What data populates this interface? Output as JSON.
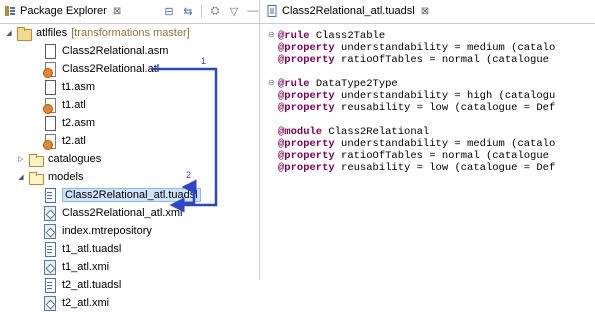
{
  "explorer": {
    "title": "Package Explorer",
    "close": "⊠",
    "toolbar": {
      "collapse": "⊟",
      "link": "⇆",
      "focus": "⛭",
      "menu": "▽",
      "minimize": "—",
      "maximize": "☐"
    },
    "project": {
      "name": "atlfiles",
      "decoration": "[transformations master]"
    },
    "project_files": [
      "Class2Relational.asm",
      "Class2Relational.atl",
      "t1.asm",
      "t1.atl",
      "t2.asm",
      "t2.atl"
    ],
    "catalogues": "catalogues",
    "models": "models",
    "model_files": [
      "Class2Relational_atl.tuadsl",
      "Class2Relational_atl.xmi",
      "index.mtrepository",
      "t1_atl.tuadsl",
      "t1_atl.xmi",
      "t2_atl.tuadsl",
      "t2_atl.xmi"
    ],
    "annotations": {
      "step1": "1",
      "step2": "2"
    }
  },
  "editor": {
    "tab": "Class2Relational_atl.tuadsl",
    "close": "⊠",
    "lines": [
      {
        "fold": "⊖",
        "kw": "@rule",
        "rest": " Class2Table"
      },
      {
        "fold": "",
        "kw": "@property",
        "rest": " understandability = medium (catalo"
      },
      {
        "fold": "",
        "kw": "@property",
        "rest": " ratioOfTables = normal (catalogue"
      },
      {
        "fold": "",
        "kw": "",
        "rest": ""
      },
      {
        "fold": "⊖",
        "kw": "@rule",
        "rest": " DataType2Type"
      },
      {
        "fold": "",
        "kw": "@property",
        "rest": " understandability = high (catalogu"
      },
      {
        "fold": "",
        "kw": "@property",
        "rest": " reusability = low (catalogue = Def"
      },
      {
        "fold": "",
        "kw": "",
        "rest": ""
      },
      {
        "fold": "",
        "kw": "@module",
        "rest": " Class2Relational"
      },
      {
        "fold": "",
        "kw": "@property",
        "rest": " understandability = medium (catalo"
      },
      {
        "fold": "",
        "kw": "@property",
        "rest": " ratioOfTables = normal (catalogue"
      },
      {
        "fold": "",
        "kw": "@property",
        "rest": " reusability = low (catalogue = Def"
      }
    ]
  },
  "colors": {
    "annotation": "#2d46c9",
    "keyword": "#7f0055",
    "selection": "#cfe3fb"
  }
}
